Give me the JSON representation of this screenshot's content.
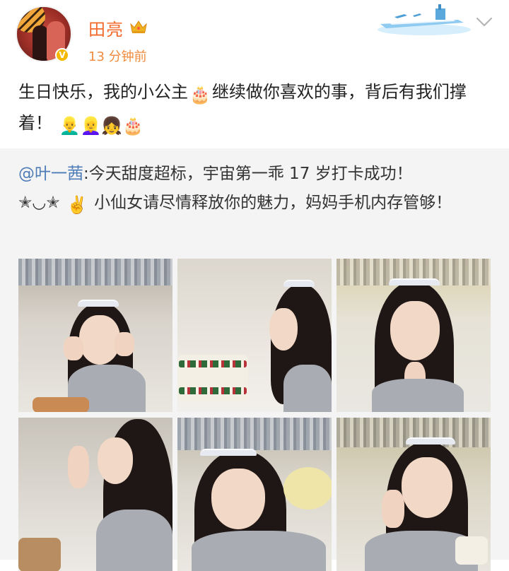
{
  "post": {
    "author_name": "田亮",
    "timestamp": "13 分钟前",
    "text_part1": "生日快乐，我的小公主",
    "emoji_cake": "🎂",
    "text_part2": "继续做你喜欢的事，背后有我们撑着！",
    "text_emojis": "👱‍♂️👱‍♀️👧🎂"
  },
  "repost": {
    "mention": "@叶一茜",
    "text_line1": ":今天甜度超标，宇宙第一乖 17 岁打卡成功！",
    "kaomoji": "✭◡✭",
    "victory_emoji": "✌️",
    "text_line2": " 小仙女请尽情释放你的魅力，妈妈手机内存管够！"
  },
  "colors": {
    "name": "#f26a2b",
    "timestamp": "#f08a3c",
    "mention": "#4d7cb7",
    "repost_bg": "#f4f4f4",
    "text": "#222222"
  },
  "icons": [
    "crown-icon",
    "v-verified-icon",
    "airplane-carrier-decoration",
    "chevron-down-icon"
  ]
}
